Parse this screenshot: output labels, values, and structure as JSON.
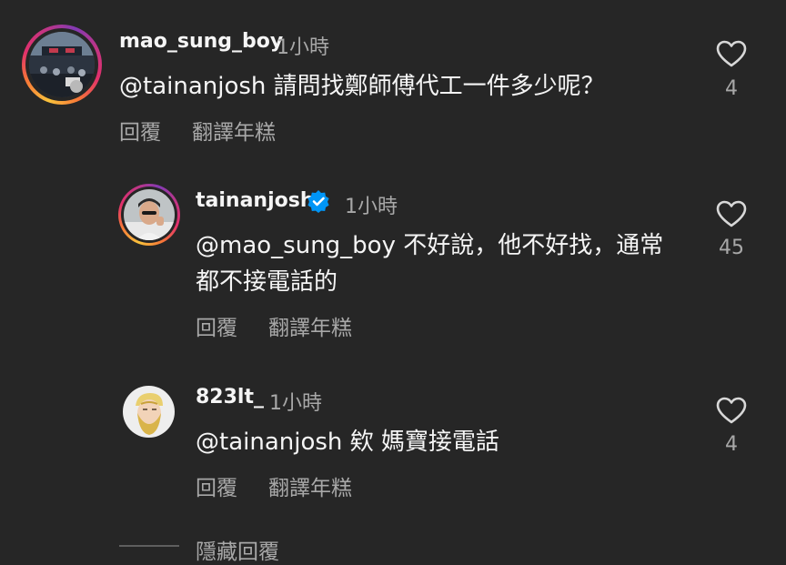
{
  "comments": [
    {
      "username": "mao_sung_boy",
      "time": "1小時",
      "text": "@tainanjosh 請問找鄭師傅代工一件多少呢？",
      "reply_label": "回覆",
      "translate_label": "翻譯年糕",
      "likes": "4",
      "verified": false
    },
    {
      "username": "tainanjosh",
      "time": "1小時",
      "text_line1": "@mao_sung_boy 不好說，他不好找，通常",
      "text_line2": "都不接電話的",
      "reply_label": "回覆",
      "translate_label": "翻譯年糕",
      "likes": "45",
      "verified": true
    },
    {
      "username": "823lt_",
      "time": "1小時",
      "text": "@tainanjosh 欸 媽寶接電話",
      "reply_label": "回覆",
      "translate_label": "翻譯年糕",
      "likes": "4",
      "verified": false
    }
  ],
  "hide_replies_label": "隱藏回覆",
  "colors": {
    "background": "#262626",
    "text_primary": "#f5f5f5",
    "text_secondary": "#a8a8a8",
    "verified_blue": "#0095f6"
  },
  "icons": {
    "like": "heart-outline-icon",
    "verified": "verified-badge-icon"
  }
}
